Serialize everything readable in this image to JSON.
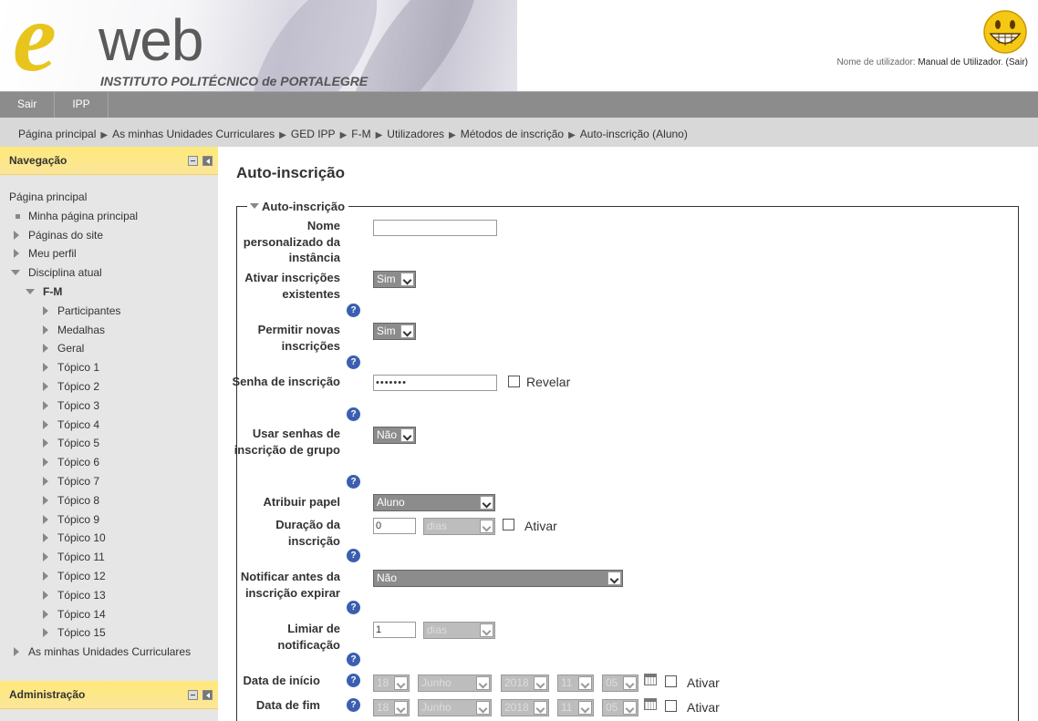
{
  "header": {
    "logo_e": "e",
    "logo_web": "web",
    "institution": "INSTITUTO POLITÉCNICO de PORTALEGRE",
    "login_prefix": "Nome de utilizador:",
    "login_user": "Manual de Utilizador",
    "logout": "(Sair)"
  },
  "menu": [
    "Sair",
    "IPP"
  ],
  "breadcrumb": [
    "Página principal",
    "As minhas Unidades Curriculares",
    "GED IPP",
    "F-M",
    "Utilizadores",
    "Métodos de inscrição",
    "Auto-inscrição (Aluno)"
  ],
  "breadcrumb_sep": "▶",
  "navigation": {
    "title": "Navegação",
    "home": "Página principal",
    "items": [
      "Minha página principal",
      "Páginas do site",
      "Meu perfil",
      "Disciplina atual"
    ],
    "course": "F-M",
    "course_items": [
      "Participantes",
      "Medalhas",
      "Geral",
      "Tópico 1",
      "Tópico 2",
      "Tópico 3",
      "Tópico 4",
      "Tópico 5",
      "Tópico 6",
      "Tópico 7",
      "Tópico 8",
      "Tópico 9",
      "Tópico 10",
      "Tópico 11",
      "Tópico 12",
      "Tópico 13",
      "Tópico 14",
      "Tópico 15"
    ],
    "my_courses": "As minhas Unidades Curriculares"
  },
  "administration": {
    "title": "Administração"
  },
  "page": {
    "title": "Auto-inscrição",
    "legend": "Auto-inscrição"
  },
  "form": {
    "name_label": "Nome personalizado da instância",
    "name_value": "",
    "existing_label": "Ativar inscrições existentes",
    "existing_value": "Sim",
    "new_label": "Permitir novas inscrições",
    "new_value": "Sim",
    "key_label": "Senha de inscrição",
    "key_value": "•••••••",
    "reveal_label": "Revelar",
    "group_label": "Usar senhas de inscrição de grupo",
    "group_value": "Não",
    "role_label": "Atribuir papel",
    "role_value": "Aluno",
    "duration_label": "Duração da inscrição",
    "duration_value": "0",
    "duration_unit": "dias",
    "enable_label": "Ativar",
    "notify_label": "Notificar antes da inscrição expirar",
    "notify_value": "Não",
    "threshold_label": "Limiar de notificação",
    "threshold_value": "1",
    "threshold_unit": "dias",
    "start_label": "Data de início",
    "end_label": "Data de fim",
    "date_day": "18",
    "date_month": "Junho",
    "date_year": "2018",
    "date_hour": "11",
    "date_minute": "05",
    "help_glyph": "?"
  }
}
